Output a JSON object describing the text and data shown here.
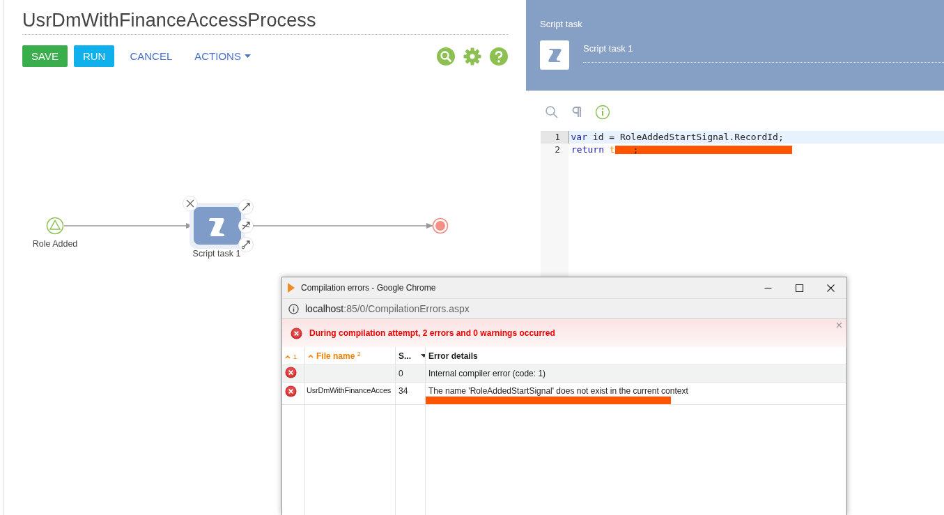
{
  "process": {
    "title": "UsrDmWithFinanceAccessProcess",
    "buttons": [
      {
        "label": "SAVE",
        "kind": "success"
      },
      {
        "label": "RUN",
        "kind": "info"
      },
      {
        "label": "CANCEL",
        "kind": "link"
      },
      {
        "label": "ACTIONS",
        "kind": "menu"
      }
    ]
  },
  "diagram": {
    "nodes": [
      {
        "kind": "start",
        "label": "Role Added"
      },
      {
        "kind": "task",
        "label": "Script task 1",
        "selected": true
      },
      {
        "kind": "end"
      }
    ]
  },
  "properties": {
    "section_title": "Script task",
    "element_name": "Script task 1"
  },
  "code": {
    "lines": [
      {
        "number": "1",
        "current": true,
        "redacted": false,
        "tokens": [
          {
            "kind": "keyword",
            "text": "var"
          },
          {
            "kind": "plain",
            "text": " id = RoleAddedStartSignal.RecordId;"
          }
        ]
      },
      {
        "number": "2",
        "current": false,
        "redacted": true,
        "tokens": [
          {
            "kind": "keyword",
            "text": "return"
          },
          {
            "kind": "ident",
            "text": "t"
          }
        ],
        "tail": ";"
      }
    ]
  },
  "popup": {
    "title": "Compilation errors - Google Chrome",
    "url_host": "localhost",
    "url_path": ":85/0/CompilationErrors.aspx",
    "alert": "During compilation attempt, 2 errors and 0 warnings occurred",
    "columns": [
      {
        "sort_index": "1",
        "sorted": true
      },
      {
        "label": "File name",
        "sort_index": "2",
        "sorted": true
      },
      {
        "label": "S...",
        "sorted": false,
        "menu": true
      },
      {
        "label": "Error details",
        "sorted": false
      }
    ],
    "rows": [
      {
        "line": "0",
        "details": "Internal compiler error (code: 1)",
        "selected": true,
        "redacted": false
      },
      {
        "file": "UsrDmWithFinanceAcces",
        "line": "34",
        "details": "The name 'RoleAddedStartSignal' does not exist in the current context",
        "selected": false,
        "redacted": true
      }
    ]
  }
}
